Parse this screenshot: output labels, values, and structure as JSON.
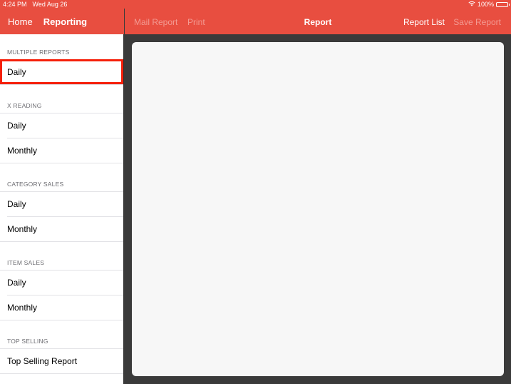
{
  "status_bar": {
    "time": "4:24 PM",
    "date": "Wed Aug 26",
    "battery": "100%",
    "icons": [
      "wifi-icon",
      "battery-icon"
    ]
  },
  "sidebar": {
    "nav": {
      "back_label": "Home",
      "title": "Reporting"
    },
    "sections": [
      {
        "header": "MULTIPLE REPORTS",
        "items": [
          "Daily"
        ]
      },
      {
        "header": "X READING",
        "items": [
          "Daily",
          "Monthly"
        ]
      },
      {
        "header": "CATEGORY SALES",
        "items": [
          "Daily",
          "Monthly"
        ]
      },
      {
        "header": "ITEM SALES",
        "items": [
          "Daily",
          "Monthly"
        ]
      },
      {
        "header": "TOP SELLING",
        "items": [
          "Top Selling Report"
        ]
      }
    ],
    "highlighted": {
      "section": 0,
      "item": 0
    }
  },
  "main": {
    "nav": {
      "mail_report_label": "Mail Report",
      "print_label": "Print",
      "title": "Report",
      "report_list_label": "Report List",
      "save_report_label": "Save Report"
    },
    "colors": {
      "accent": "#e84e40",
      "disabled_text": "#f39a92",
      "highlight_outline": "#f5200a"
    }
  }
}
